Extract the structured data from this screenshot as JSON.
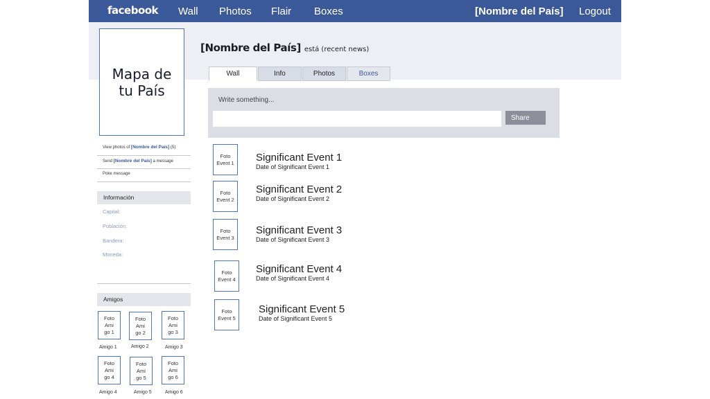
{
  "topbar": {
    "logo": "facebook",
    "nav": [
      "Wall",
      "Photos",
      "Flair",
      "Boxes"
    ],
    "country": "[Nombre del País]",
    "logout": "Logout"
  },
  "profile": {
    "picture_text": "Mapa de tu País",
    "links": {
      "view_photos_prefix": "View photos of",
      "view_photos_name": "[Nombre del País]",
      "view_photos_count": "(5)",
      "send_prefix": "Send",
      "send_name": "[Nombre del País]",
      "send_suffix": "a message",
      "poke": "Poke message"
    }
  },
  "info": {
    "heading": "Información",
    "fields": [
      "Capital:",
      "Población:",
      "Bandera:",
      "Moneda:"
    ]
  },
  "friends": {
    "heading": "Amigos",
    "items": [
      {
        "pic": "Foto Ami go 1",
        "name": "Amigo 1"
      },
      {
        "pic": "Foto Ami go 2",
        "name": "Amigo 2"
      },
      {
        "pic": "Foto Ami go 3",
        "name": "Amigo 3"
      },
      {
        "pic": "Foto Ami go 4",
        "name": "Amigo 4"
      },
      {
        "pic": "Foto Ami go 5",
        "name": "Amigo 5"
      },
      {
        "pic": "Foto Ami go 6",
        "name": "Amigo 6"
      }
    ]
  },
  "main": {
    "title_name": "[Nombre del País]",
    "title_suffix": "está (recent news)",
    "tabs": [
      "Wall",
      "Info",
      "Photos",
      "Boxes"
    ],
    "active_tab": "Wall",
    "composer": {
      "prompt": "Write something...",
      "value": "",
      "share": "Share"
    },
    "events": [
      {
        "pic": "Foto Event 1",
        "title": "Significant Event 1",
        "date": "Date of Significant Event 1"
      },
      {
        "pic": "Foto Event 2",
        "title": "Significant Event 2",
        "date": "Date of Significant Event 2"
      },
      {
        "pic": "Foto Event 3",
        "title": "Significant Event 3",
        "date": "Date of Significant Event 3"
      },
      {
        "pic": "Foto Event 4",
        "title": "Significant Event 4",
        "date": "Date of Significant Event 4"
      },
      {
        "pic": "Foto Event 5",
        "title": "Significant Event 5",
        "date": "Date of Significant Event 5"
      }
    ]
  },
  "colors": {
    "topbar": "#3b5998",
    "band": "#edeff4",
    "picture_border": "#4a75c2",
    "composer_bg": "#dcdee6",
    "share_button": "#8c8f9a"
  }
}
